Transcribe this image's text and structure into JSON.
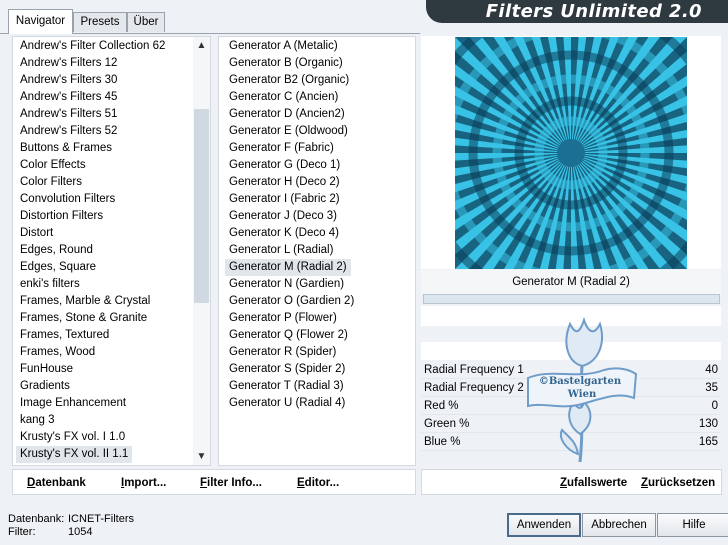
{
  "tabs": [
    "Navigator",
    "Presets",
    "Über"
  ],
  "app_title": "Filters Unlimited 2.0",
  "categories": [
    "Andrew's Filter Collection 62",
    "Andrew's Filters 12",
    "Andrew's Filters 30",
    "Andrew's Filters 45",
    "Andrew's Filters 51",
    "Andrew's Filters 52",
    "Buttons & Frames",
    "Color Effects",
    "Color Filters",
    "Convolution Filters",
    "Distortion Filters",
    "Distort",
    "Edges, Round",
    "Edges, Square",
    "enki's filters",
    "Frames, Marble & Crystal",
    "Frames, Stone & Granite",
    "Frames, Textured",
    "Frames, Wood",
    "FunHouse",
    "Gradients",
    "Image Enhancement",
    "kang 3",
    "Krusty's FX vol. I 1.0",
    "Krusty's FX vol. II 1.1"
  ],
  "selected_category": "Krusty's FX vol. II 1.1",
  "filters": [
    "Generator A (Metalic)",
    "Generator B (Organic)",
    "Generator B2 (Organic)",
    "Generator C (Ancien)",
    "Generator D (Ancien2)",
    "Generator E (Oldwood)",
    "Generator F (Fabric)",
    "Generator G (Deco 1)",
    "Generator H (Deco 2)",
    "Generator I (Fabric 2)",
    "Generator J (Deco 3)",
    "Generator K (Deco 4)",
    "Generator L (Radial)",
    "Generator M (Radial 2)",
    "Generator N (Gardien)",
    "Generator O (Gardien 2)",
    "Generator P (Flower)",
    "Generator Q (Flower 2)",
    "Generator R (Spider)",
    "Generator S (Spider 2)",
    "Generator T (Radial 3)",
    "Generator U (Radial 4)"
  ],
  "selected_filter": "Generator M (Radial 2)",
  "preview": {
    "filter_name": "Generator M (Radial 2)"
  },
  "params": [
    {
      "label": "Radial Frequency 1",
      "value": "40"
    },
    {
      "label": "Radial Frequency 2",
      "value": "35"
    },
    {
      "label": "Red %",
      "value": "0"
    },
    {
      "label": "Green %",
      "value": "130"
    },
    {
      "label": "Blue %",
      "value": "165"
    }
  ],
  "watermark": {
    "line1": "©Bastelgarten",
    "line2": "Wien"
  },
  "left_buttons": [
    {
      "underline": "D",
      "rest": "atenbank"
    },
    {
      "underline": "I",
      "rest": "mport..."
    },
    {
      "underline": "F",
      "rest": "ilter Info..."
    },
    {
      "underline": "E",
      "rest": "ditor..."
    }
  ],
  "right_buttons": {
    "random": {
      "underline": "Z",
      "rest": "ufallswerte"
    },
    "reset": {
      "underline": "Z",
      "rest": "urücksetzen"
    }
  },
  "status": {
    "db_label": "Datenbank:",
    "db_value": "ICNET-Filters",
    "filter_label": "Filter:",
    "filter_value": "1054"
  },
  "buttons": {
    "apply": "Anwenden",
    "cancel": "Abbrechen",
    "help": "Hilfe"
  },
  "colors": {
    "preview_dark": "#0b3f59",
    "preview_light": "#38c3e6",
    "banner": "#2f3a40",
    "watermark": "#6f9cc8"
  }
}
